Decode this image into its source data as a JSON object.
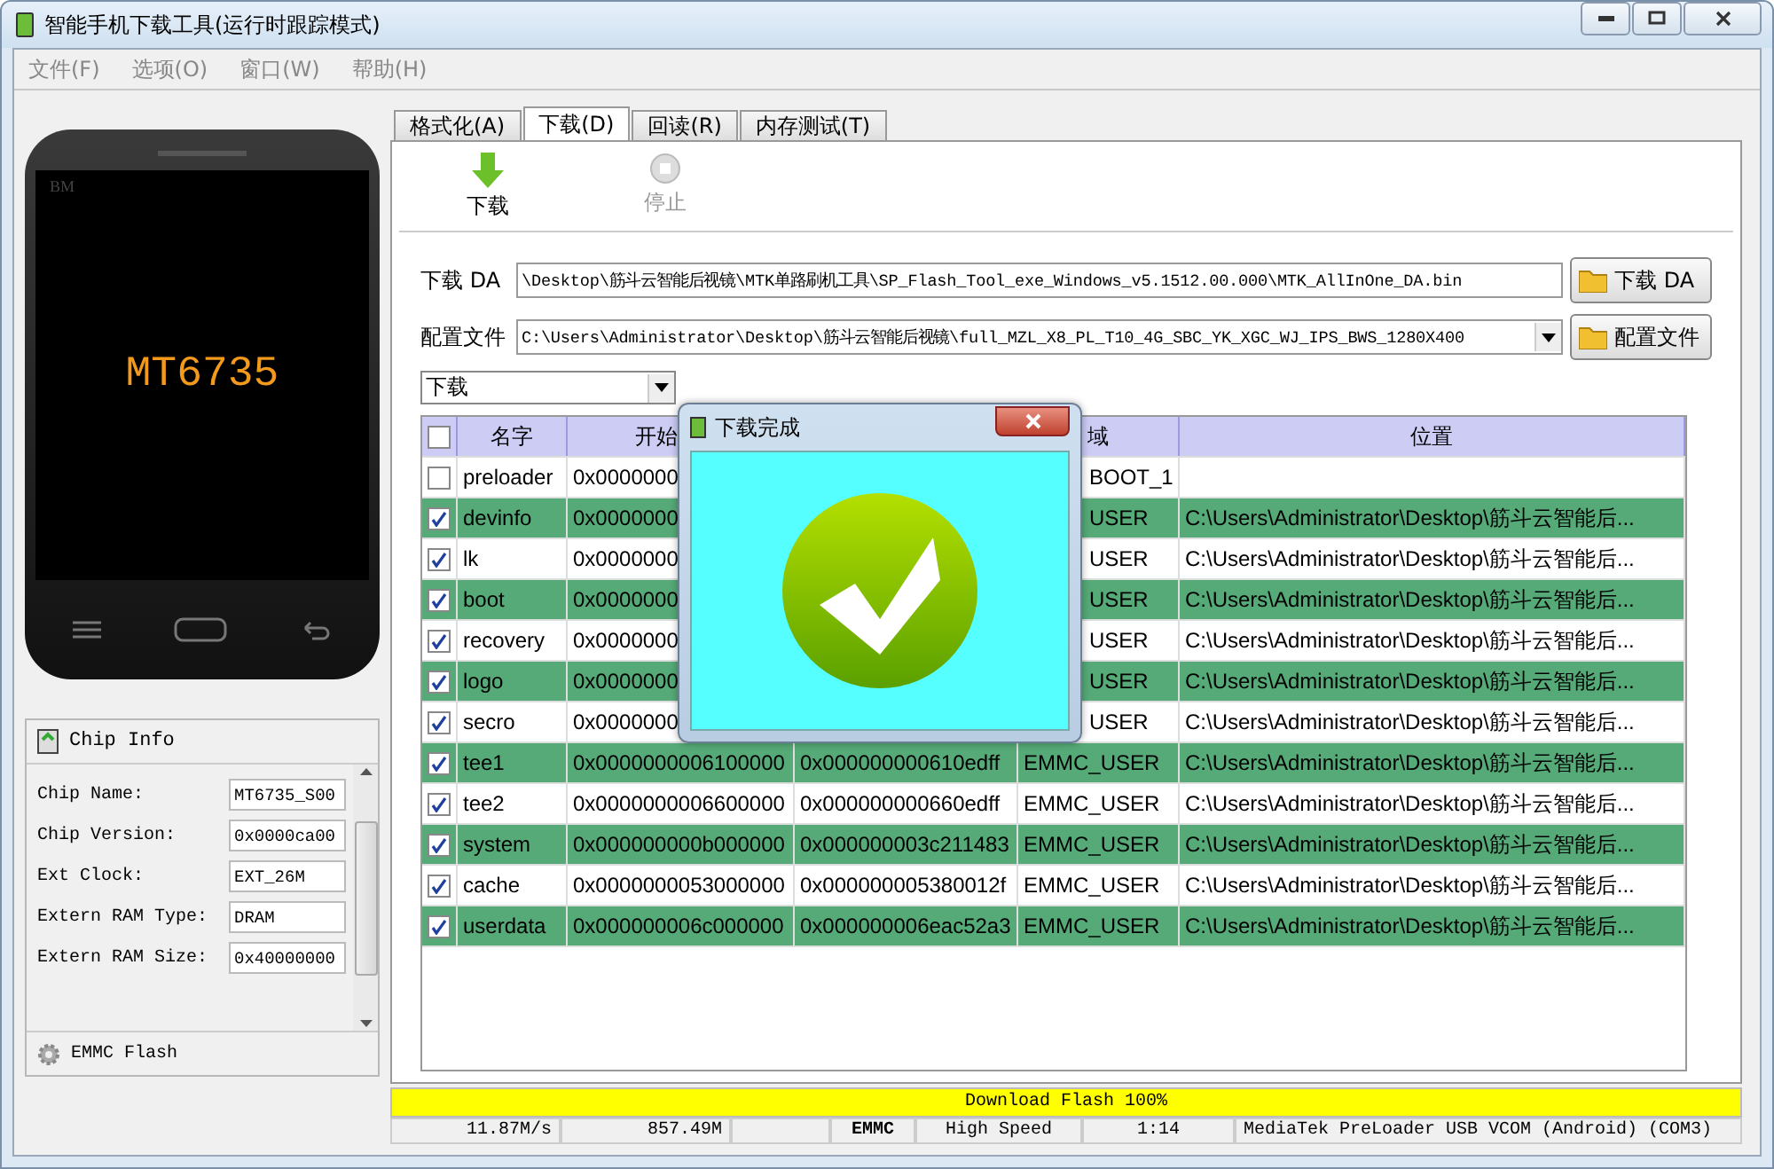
{
  "window": {
    "title": "智能手机下载工具(运行时跟踪模式)"
  },
  "menu": [
    "文件(F)",
    "选项(O)",
    "窗口(W)",
    "帮助(H)"
  ],
  "phone": {
    "brand": "BM",
    "chip": "MT6735"
  },
  "chip_info": {
    "title": "Chip Info",
    "fields": [
      {
        "label": "Chip Name:",
        "value": "MT6735_S00"
      },
      {
        "label": "Chip Version:",
        "value": "0x0000ca00"
      },
      {
        "label": "Ext Clock:",
        "value": "EXT_26M"
      },
      {
        "label": "Extern RAM Type:",
        "value": "DRAM"
      },
      {
        "label": "Extern RAM Size:",
        "value": "0x40000000"
      }
    ],
    "footer": "EMMC Flash"
  },
  "tabs": [
    {
      "label": "格式化(A)",
      "selected": false
    },
    {
      "label": "下载(D)",
      "selected": true
    },
    {
      "label": "回读(R)",
      "selected": false
    },
    {
      "label": "内存测试(T)",
      "selected": false
    }
  ],
  "toolbar": [
    {
      "label": "下载",
      "disabled": false
    },
    {
      "label": "停止",
      "disabled": true
    }
  ],
  "da": {
    "label": "下载 DA",
    "value": "\\Desktop\\筋斗云智能后视镜\\MTK单路刷机工具\\SP_Flash_Tool_exe_Windows_v5.1512.00.000\\MTK_AllInOne_DA.bin",
    "button": "下载 DA"
  },
  "scatter": {
    "label": "配置文件",
    "value": "C:\\Users\\Administrator\\Desktop\\筋斗云智能后视镜\\full_MZL_X8_PL_T10_4G_SBC_YK_XGC_WJ_IPS_BWS_1280X400",
    "button": "配置文件"
  },
  "mode": {
    "value": "下载"
  },
  "table": {
    "all_checked": false,
    "columns": [
      {
        "label": "名字"
      },
      {
        "label": "开始"
      },
      {},
      {
        "label": "域"
      },
      {
        "label": "位置"
      }
    ],
    "rows": [
      {
        "checked": false,
        "covered": true,
        "name": "preloader",
        "start": "0x0000000",
        "region": "BOOT_1"
      },
      {
        "checked": true,
        "covered": true,
        "name": "devinfo",
        "start": "0x0000000",
        "region": "USER",
        "location": "C:\\Users\\Administrator\\Desktop\\筋斗云智能后..."
      },
      {
        "checked": true,
        "covered": true,
        "name": "lk",
        "start": "0x0000000",
        "region": "USER",
        "location": "C:\\Users\\Administrator\\Desktop\\筋斗云智能后..."
      },
      {
        "checked": true,
        "covered": true,
        "name": "boot",
        "start": "0x0000000",
        "region": "USER",
        "location": "C:\\Users\\Administrator\\Desktop\\筋斗云智能后..."
      },
      {
        "checked": true,
        "covered": true,
        "name": "recovery",
        "start": "0x0000000",
        "region": "USER",
        "location": "C:\\Users\\Administrator\\Desktop\\筋斗云智能后..."
      },
      {
        "checked": true,
        "covered": true,
        "name": "logo",
        "start": "0x0000000",
        "region": "USER",
        "location": "C:\\Users\\Administrator\\Desktop\\筋斗云智能后..."
      },
      {
        "checked": true,
        "covered": true,
        "name": "secro",
        "start": "0x0000000",
        "region": "USER",
        "location": "C:\\Users\\Administrator\\Desktop\\筋斗云智能后..."
      },
      {
        "checked": true,
        "covered": false,
        "name": "tee1",
        "start": "0x0000000006100000",
        "end": "0x000000000610edff",
        "region": "EMMC_USER",
        "location": "C:\\Users\\Administrator\\Desktop\\筋斗云智能后..."
      },
      {
        "checked": true,
        "covered": false,
        "name": "tee2",
        "start": "0x0000000006600000",
        "end": "0x000000000660edff",
        "region": "EMMC_USER",
        "location": "C:\\Users\\Administrator\\Desktop\\筋斗云智能后..."
      },
      {
        "checked": true,
        "covered": false,
        "name": "system",
        "start": "0x000000000b000000",
        "end": "0x000000003c211483",
        "region": "EMMC_USER",
        "location": "C:\\Users\\Administrator\\Desktop\\筋斗云智能后..."
      },
      {
        "checked": true,
        "covered": false,
        "name": "cache",
        "start": "0x0000000053000000",
        "end": "0x000000005380012f",
        "region": "EMMC_USER",
        "location": "C:\\Users\\Administrator\\Desktop\\筋斗云智能后..."
      },
      {
        "checked": true,
        "covered": false,
        "name": "userdata",
        "start": "0x000000006c000000",
        "end": "0x000000006eac52a3",
        "region": "EMMC_USER",
        "location": "C:\\Users\\Administrator\\Desktop\\筋斗云智能后..."
      }
    ]
  },
  "dialog": {
    "title": "下载完成"
  },
  "progress": {
    "label": "Download Flash 100%",
    "level": 1
  },
  "status_bar": [
    {
      "text": "11.87M/s",
      "kind": "right"
    },
    {
      "text": "857.49M",
      "kind": "right"
    },
    {
      "kind": "blank"
    },
    {
      "text": "EMMC",
      "kind": "bold"
    },
    {
      "text": "High Speed",
      "kind": "center"
    },
    {
      "text": "1:14",
      "kind": "center"
    },
    {
      "text": "MediaTek PreLoader USB VCOM (Android) (COM3)",
      "kind": "left"
    }
  ]
}
